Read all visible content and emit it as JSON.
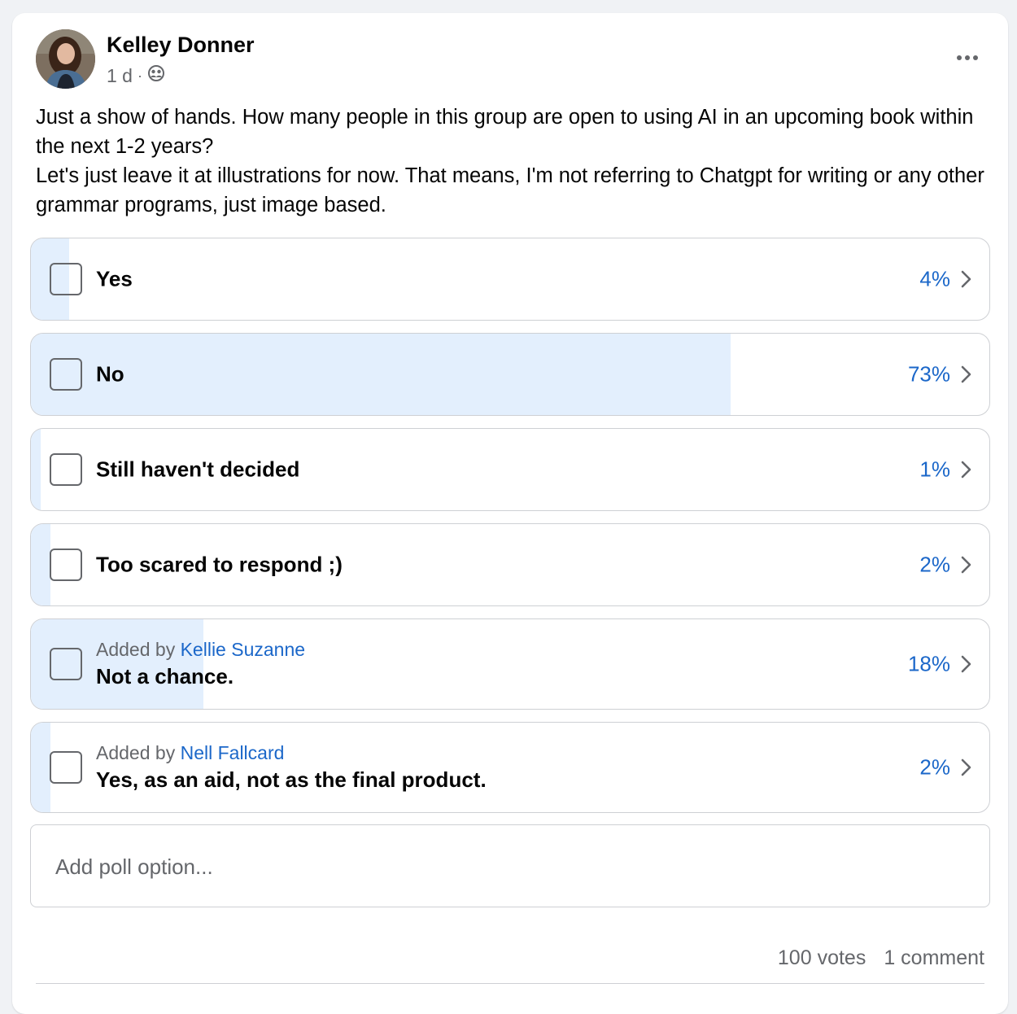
{
  "post": {
    "author": "Kelley Donner",
    "time": "1 d",
    "separator": "·",
    "audience_icon": "group-icon",
    "text_line1": "Just a show of hands. How many people in this group are open to using AI in an upcoming book within the next 1-2 years?",
    "text_line2": "Let's just leave it at illustrations for now. That means, I'm not referring to Chatgpt for writing or any other grammar programs, just image based."
  },
  "poll": {
    "options": [
      {
        "label": "Yes",
        "percent_text": "4%",
        "percent": 4
      },
      {
        "label": "No",
        "percent_text": "73%",
        "percent": 73
      },
      {
        "label": "Still haven't decided",
        "percent_text": "1%",
        "percent": 1
      },
      {
        "label": "Too scared to respond ;)",
        "percent_text": "2%",
        "percent": 2
      },
      {
        "added_by_prefix": "Added by",
        "added_by_name": "Kellie Suzanne",
        "label": "Not a chance.",
        "percent_text": "18%",
        "percent": 18
      },
      {
        "added_by_prefix": "Added by",
        "added_by_name": "Nell Fallcard",
        "label": "Yes, as an aid, not as the final product.",
        "percent_text": "2%",
        "percent": 2
      }
    ],
    "add_option_placeholder": "Add poll option..."
  },
  "footer": {
    "votes": "100 votes",
    "comments": "1 comment"
  },
  "colors": {
    "accent": "#1b67c9",
    "fill": "#e3effd",
    "muted": "#65676b"
  }
}
